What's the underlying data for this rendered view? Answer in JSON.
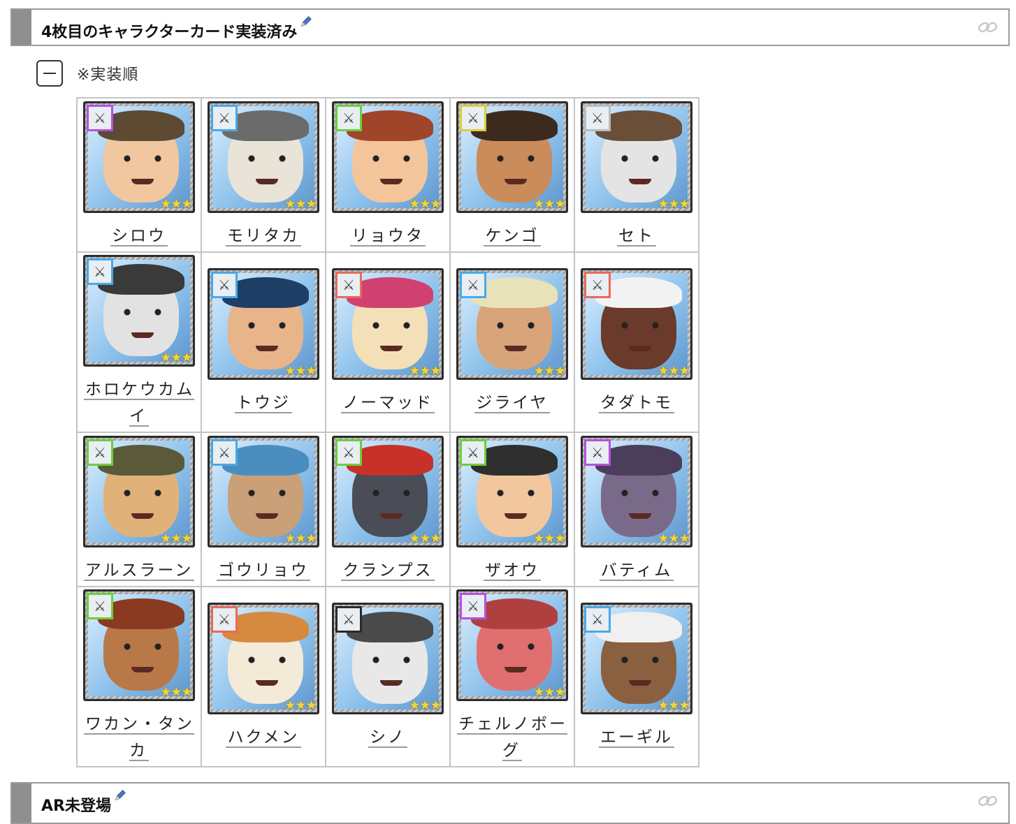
{
  "section1": {
    "title": "4枚目のキャラクターカード実装済み"
  },
  "note": "※実装順",
  "characters": [
    {
      "name": "シロウ",
      "weapon_color": "#b84fe0",
      "skin": "#f1c7a0",
      "hair": "#5c4a33"
    },
    {
      "name": "モリタカ",
      "weapon_color": "#4aa8e8",
      "skin": "#e9e3d8",
      "hair": "#6b6b6b"
    },
    {
      "name": "リョウタ",
      "weapon_color": "#6ccf3a",
      "skin": "#f4c59b",
      "hair": "#a0442a"
    },
    {
      "name": "ケンゴ",
      "weapon_color": "#d8cf3b",
      "skin": "#c98c5a",
      "hair": "#3d2a1f"
    },
    {
      "name": "セト",
      "weapon_color": "#bdbdbd",
      "skin": "#e4e4e4",
      "hair": "#6a4e38"
    },
    {
      "name": "ホロケウカムイ",
      "weapon_color": "#4aa8e8",
      "skin": "#e2e2e2",
      "hair": "#3a3a3a"
    },
    {
      "name": "トウジ",
      "weapon_color": "#4aa8e8",
      "skin": "#e8b48a",
      "hair": "#1f3e66"
    },
    {
      "name": "ノーマッド",
      "weapon_color": "#e86a5a",
      "skin": "#f4e0b8",
      "hair": "#d04070"
    },
    {
      "name": "ジライヤ",
      "weapon_color": "#4aa8e8",
      "skin": "#d8a47a",
      "hair": "#e8e2b8"
    },
    {
      "name": "タダトモ",
      "weapon_color": "#e86a5a",
      "skin": "#6a3a2a",
      "hair": "#f2f2f2"
    },
    {
      "name": "アルスラーン",
      "weapon_color": "#6ccf3a",
      "skin": "#e0b27a",
      "hair": "#5a5a3a"
    },
    {
      "name": "ゴウリョウ",
      "weapon_color": "#4aa8e8",
      "skin": "#c9a078",
      "hair": "#4a8ec0"
    },
    {
      "name": "クランプス",
      "weapon_color": "#6ccf3a",
      "skin": "#4a4d55",
      "hair": "#c8302a"
    },
    {
      "name": "ザオウ",
      "weapon_color": "#6ccf3a",
      "skin": "#f2c79e",
      "hair": "#2f2f2f"
    },
    {
      "name": "バティム",
      "weapon_color": "#b84fe0",
      "skin": "#7a6a8a",
      "hair": "#4a3e5a"
    },
    {
      "name": "ワカン・タンカ",
      "weapon_color": "#6ccf3a",
      "skin": "#b97848",
      "hair": "#8a3a20"
    },
    {
      "name": "ハクメン",
      "weapon_color": "#e86a5a",
      "skin": "#f4ead8",
      "hair": "#d68a40"
    },
    {
      "name": "シノ",
      "weapon_color": "#2a2a2a",
      "skin": "#e8e8e8",
      "hair": "#4a4a4a"
    },
    {
      "name": "チェルノボーグ",
      "weapon_color": "#b84fe0",
      "skin": "#e07070",
      "hair": "#b04040"
    },
    {
      "name": "エーギル",
      "weapon_color": "#4aa8e8",
      "skin": "#8a6040",
      "hair": "#f0f0f0"
    }
  ],
  "stars": "★★★",
  "section2": {
    "title": "AR未登場"
  }
}
